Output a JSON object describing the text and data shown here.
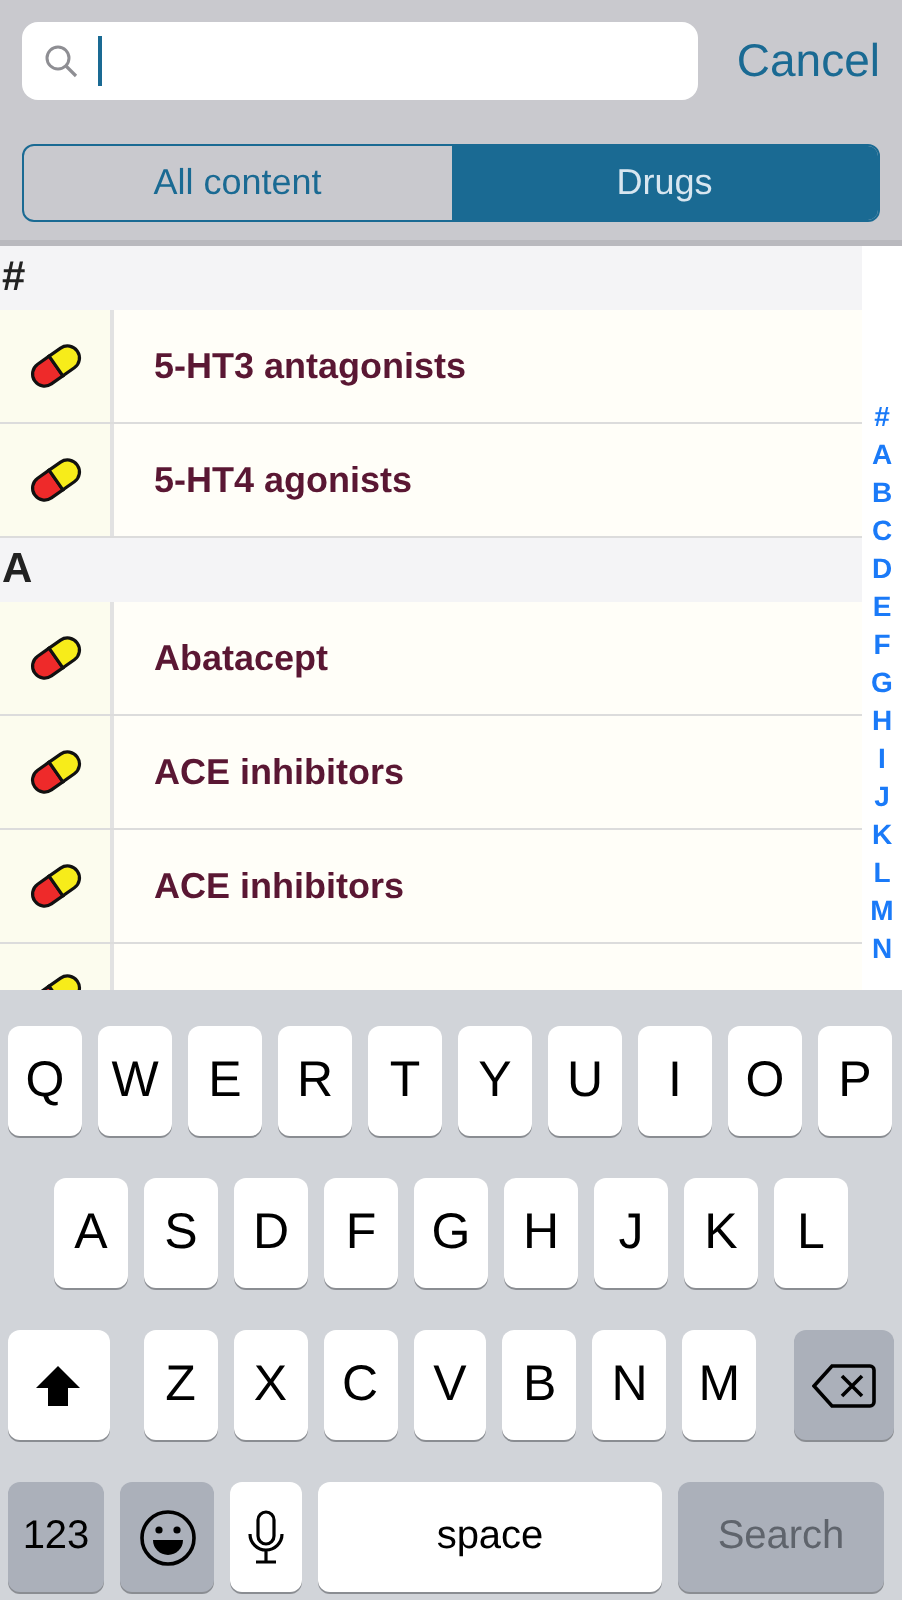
{
  "search": {
    "cancel": "Cancel"
  },
  "tabs": [
    {
      "label": "All content",
      "selected": false
    },
    {
      "label": "Drugs",
      "selected": true
    }
  ],
  "sections": [
    {
      "title": "#",
      "items": [
        {
          "label": "5-HT3 antagonists"
        },
        {
          "label": "5-HT4 agonists"
        }
      ]
    },
    {
      "title": "A",
      "items": [
        {
          "label": "Abatacept"
        },
        {
          "label": "ACE inhibitors"
        },
        {
          "label": "ACE inhibitors"
        },
        {
          "kind": "partial"
        }
      ]
    }
  ],
  "index": [
    "#",
    "A",
    "B",
    "C",
    "D",
    "E",
    "F",
    "G",
    "H",
    "I",
    "J",
    "K",
    "L",
    "M",
    "N"
  ],
  "keyboard": [
    [
      {
        "kind": "letter",
        "label": "Q"
      },
      {
        "kind": "letter",
        "label": "W"
      },
      {
        "kind": "letter",
        "label": "E"
      },
      {
        "kind": "letter",
        "label": "R"
      },
      {
        "kind": "letter",
        "label": "T"
      },
      {
        "kind": "letter",
        "label": "Y"
      },
      {
        "kind": "letter",
        "label": "U"
      },
      {
        "kind": "letter",
        "label": "I"
      },
      {
        "kind": "letter",
        "label": "O"
      },
      {
        "kind": "letter",
        "label": "P"
      }
    ],
    [
      {
        "kind": "letter",
        "label": "A"
      },
      {
        "kind": "letter",
        "label": "S"
      },
      {
        "kind": "letter",
        "label": "D"
      },
      {
        "kind": "letter",
        "label": "F"
      },
      {
        "kind": "letter",
        "label": "G"
      },
      {
        "kind": "letter",
        "label": "H"
      },
      {
        "kind": "letter",
        "label": "J"
      },
      {
        "kind": "letter",
        "label": "K"
      },
      {
        "kind": "letter",
        "label": "L"
      }
    ],
    [
      {
        "kind": "shift"
      },
      {
        "kind": "letter",
        "label": "Z"
      },
      {
        "kind": "letter",
        "label": "X"
      },
      {
        "kind": "letter",
        "label": "C"
      },
      {
        "kind": "letter",
        "label": "V"
      },
      {
        "kind": "letter",
        "label": "B"
      },
      {
        "kind": "letter",
        "label": "N"
      },
      {
        "kind": "letter",
        "label": "M"
      },
      {
        "kind": "backspace"
      }
    ],
    [
      {
        "kind": "numbers",
        "label": "123"
      },
      {
        "kind": "emoji"
      },
      {
        "kind": "mic"
      },
      {
        "kind": "space",
        "label": "space"
      },
      {
        "kind": "search",
        "label": "Search",
        "disabled": true
      }
    ]
  ]
}
